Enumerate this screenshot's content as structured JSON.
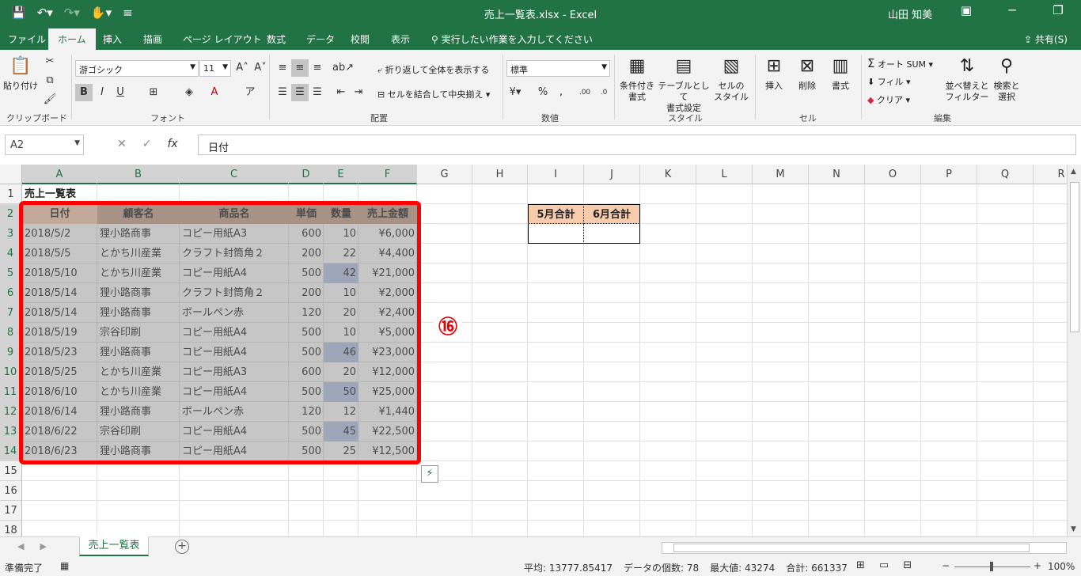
{
  "window": {
    "title": "売上一覧表.xlsx  -  Excel",
    "user": "山田 知美"
  },
  "tabs": [
    "ファイル",
    "ホーム",
    "挿入",
    "描画",
    "ページ レイアウト",
    "数式",
    "データ",
    "校閲",
    "表示"
  ],
  "tell_me": "実行したい作業を入力してください",
  "share": "共有(S)",
  "ribbon": {
    "paste": "貼り付け",
    "clipboard": "クリップボード",
    "font_name": "游ゴシック",
    "font_size": "11",
    "font": "フォント",
    "wrap_text": "折り返して全体を表示する",
    "merge_center": "セルを結合して中央揃え",
    "alignment": "配置",
    "number_format": "標準",
    "number": "数値",
    "conditional": "条件付き\n書式",
    "format_table": "テーブルとして\n書式設定",
    "cell_styles": "セルの\nスタイル",
    "styles": "スタイル",
    "insert": "挿入",
    "delete": "削除",
    "format": "書式",
    "cells": "セル",
    "autosum": "オート SUM",
    "fill": "フィル",
    "clear": "クリア",
    "sort_filter": "並べ替えと\nフィルター",
    "find_select": "検索と\n選択",
    "editing": "編集"
  },
  "formula_bar": {
    "name_box": "A2",
    "formula": "日付"
  },
  "columns": [
    "A",
    "B",
    "C",
    "D",
    "E",
    "F",
    "G",
    "H",
    "I",
    "J",
    "K",
    "L",
    "M",
    "N",
    "O",
    "P",
    "Q",
    "R"
  ],
  "rows": [
    "1",
    "2",
    "3",
    "4",
    "5",
    "6",
    "7",
    "8",
    "9",
    "10",
    "11",
    "12",
    "13",
    "14",
    "15",
    "16",
    "17",
    "18"
  ],
  "sheet": {
    "title": "売上一覧表",
    "headers": [
      "日付",
      "顧客名",
      "商品名",
      "単価",
      "数量",
      "売上金額"
    ],
    "data": [
      [
        "2018/5/2",
        "狸小路商事",
        "コピー用紙A3",
        "600",
        "10",
        "¥6,000"
      ],
      [
        "2018/5/5",
        "とかち川産業",
        "クラフト封筒角２",
        "200",
        "22",
        "¥4,400"
      ],
      [
        "2018/5/10",
        "とかち川産業",
        "コピー用紙A4",
        "500",
        "42",
        "¥21,000"
      ],
      [
        "2018/5/14",
        "狸小路商事",
        "クラフト封筒角２",
        "200",
        "10",
        "¥2,000"
      ],
      [
        "2018/5/14",
        "狸小路商事",
        "ボールペン赤",
        "120",
        "20",
        "¥2,400"
      ],
      [
        "2018/5/19",
        "宗谷印刷",
        "コピー用紙A4",
        "500",
        "10",
        "¥5,000"
      ],
      [
        "2018/5/23",
        "狸小路商事",
        "コピー用紙A4",
        "500",
        "46",
        "¥23,000"
      ],
      [
        "2018/5/25",
        "とかち川産業",
        "コピー用紙A3",
        "600",
        "20",
        "¥12,000"
      ],
      [
        "2018/6/10",
        "とかち川産業",
        "コピー用紙A4",
        "500",
        "50",
        "¥25,000"
      ],
      [
        "2018/6/14",
        "狸小路商事",
        "ボールペン赤",
        "120",
        "12",
        "¥1,440"
      ],
      [
        "2018/6/22",
        "宗谷印刷",
        "コピー用紙A4",
        "500",
        "45",
        "¥22,500"
      ],
      [
        "2018/6/23",
        "狸小路商事",
        "コピー用紙A4",
        "500",
        "25",
        "¥12,500"
      ]
    ],
    "summary_headers": [
      "5月合計",
      "6月合計"
    ],
    "badge": "⑯"
  },
  "sheet_tab": "売上一覧表",
  "status": {
    "ready": "準備完了",
    "average": "平均: 13777.85417",
    "count": "データの個数: 78",
    "max": "最大値: 43274",
    "sum": "合計: 661337",
    "zoom": "100%"
  },
  "colors": {
    "excel_green": "#217346",
    "header_orange": "#f8cbad",
    "header_brown": "#c9a089",
    "highlight_blue": "#b4c6e7",
    "annotation_red": "#ff0000"
  }
}
